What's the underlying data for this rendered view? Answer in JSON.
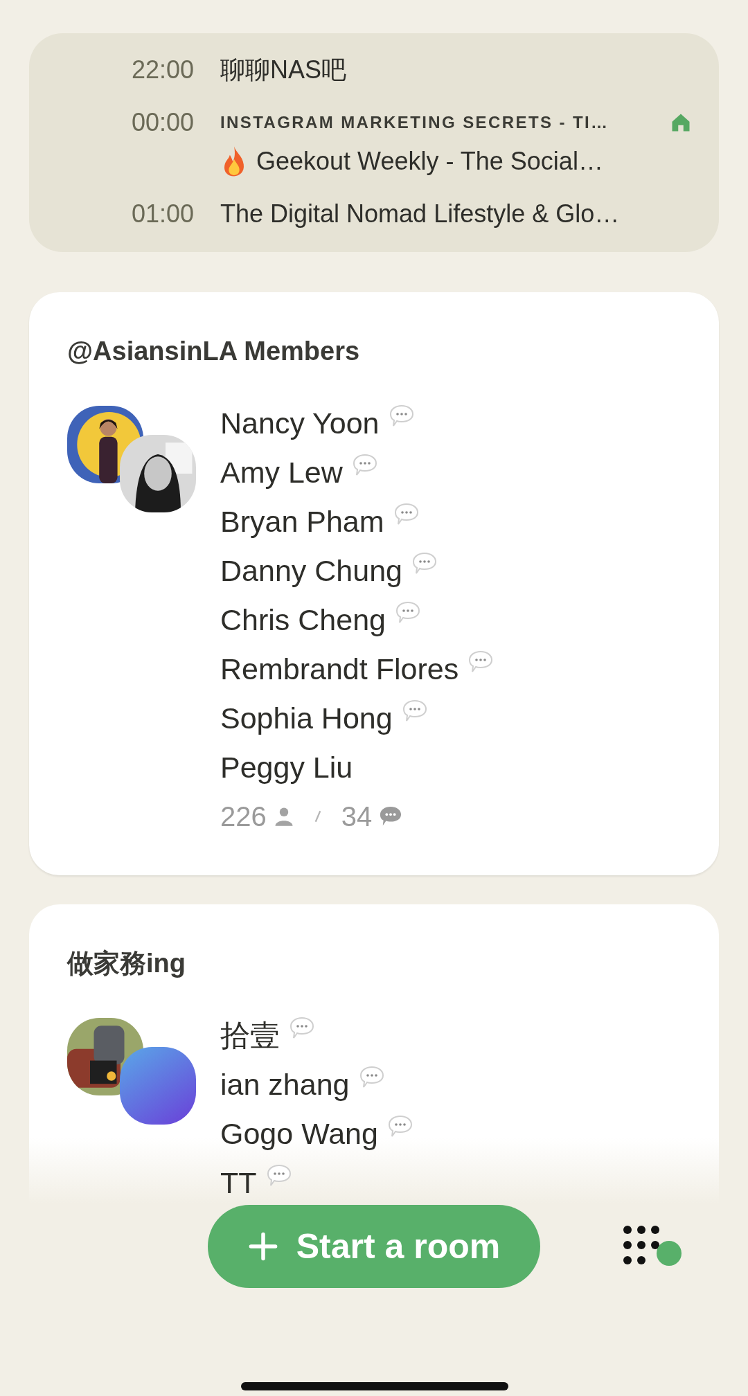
{
  "schedule": [
    {
      "time": "22:00",
      "title": "聊聊NAS吧",
      "hot": false
    },
    {
      "time": "00:00",
      "club": "INSTAGRAM MARKETING SECRETS - TI…",
      "title": "Geekout Weekly - The Social…",
      "hot": true
    },
    {
      "time": "01:00",
      "title": "The Digital Nomad Lifestyle & Glo…",
      "hot": false
    }
  ],
  "rooms": [
    {
      "title": "@AsiansinLA Members",
      "avatars": [
        {
          "kind": "picture"
        },
        {
          "kind": "picture"
        }
      ],
      "members": [
        {
          "name": "Nancy Yoon",
          "speaker": true
        },
        {
          "name": "Amy Lew",
          "speaker": true
        },
        {
          "name": "Bryan Pham",
          "speaker": true
        },
        {
          "name": "Danny Chung",
          "speaker": true
        },
        {
          "name": "Chris Cheng",
          "speaker": true
        },
        {
          "name": "Rembrandt Flores",
          "speaker": true
        },
        {
          "name": "Sophia Hong",
          "speaker": true
        },
        {
          "name": "Peggy Liu",
          "speaker": false
        }
      ],
      "listeners": "226",
      "speakers": "34"
    },
    {
      "title": "做家務ing",
      "avatars": [
        {
          "kind": "picture"
        },
        {
          "kind": "gradient"
        }
      ],
      "members": [
        {
          "name": "拾壹",
          "speaker": true
        },
        {
          "name": "ian zhang",
          "speaker": true
        },
        {
          "name": "Gogo Wang",
          "speaker": true
        },
        {
          "name": "TT",
          "speaker": true
        }
      ]
    }
  ],
  "start_button": {
    "label": "Start a room"
  }
}
